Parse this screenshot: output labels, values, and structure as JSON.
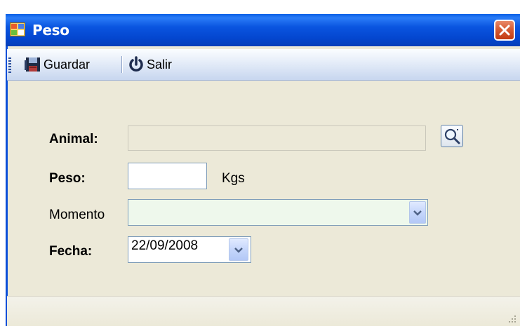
{
  "window": {
    "title": "Peso",
    "close_icon": "close-icon"
  },
  "toolbar": {
    "save_label": "Guardar",
    "save_icon": "floppy-disk-icon",
    "exit_label": "Salir",
    "exit_icon": "power-icon"
  },
  "form": {
    "animal": {
      "label": "Animal:",
      "value": "",
      "lookup_icon": "magnifier-icon"
    },
    "peso": {
      "label": "Peso:",
      "value": "",
      "unit": "Kgs"
    },
    "momento": {
      "label": "Momento",
      "value": ""
    },
    "fecha": {
      "label": "Fecha:",
      "value": "22/09/2008"
    }
  },
  "colors": {
    "titlebar": "#0a55e0",
    "window_bg": "#ece9d8",
    "momento_bg": "#eef8ec",
    "close_button": "#d65c34"
  }
}
